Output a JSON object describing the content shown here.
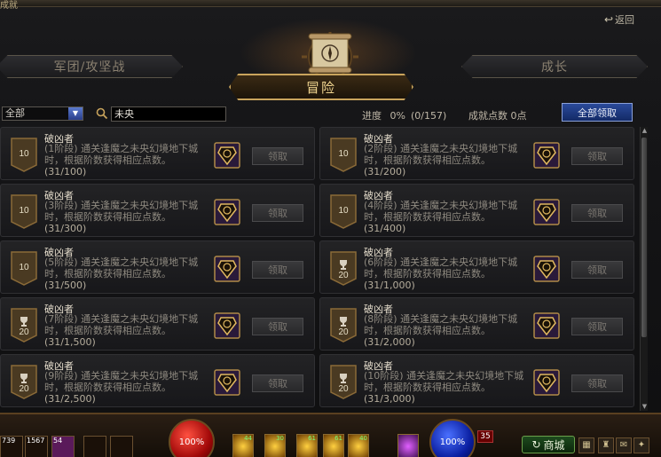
{
  "window": {
    "title": "成就",
    "back_label": "返回"
  },
  "tabs": {
    "left": "军团/攻坚战",
    "active": "冒险",
    "right": "成长"
  },
  "filter": {
    "category_value": "全部",
    "search_value": "未央"
  },
  "stats": {
    "progress_label": "进度",
    "progress_percent": "0%",
    "progress_count": "(0/157)",
    "points_label": "成就点数",
    "points_value": "0点"
  },
  "claim_all_label": "全部领取",
  "achievements": [
    {
      "title": "破凶者",
      "desc": "(1阶段) 通关逢魔之未央幻境地下城时，根据阶数获得相应点数。",
      "progress": "(31/100)",
      "badge": "10",
      "trophy": false,
      "claim": "领取"
    },
    {
      "title": "破凶者",
      "desc": "(2阶段) 通关逢魔之未央幻境地下城时，根据阶数获得相应点数。",
      "progress": "(31/200)",
      "badge": "10",
      "trophy": false,
      "claim": "领取"
    },
    {
      "title": "破凶者",
      "desc": "(3阶段) 通关逢魔之未央幻境地下城时，根据阶数获得相应点数。",
      "progress": "(31/300)",
      "badge": "10",
      "trophy": false,
      "claim": "领取"
    },
    {
      "title": "破凶者",
      "desc": "(4阶段) 通关逢魔之未央幻境地下城时，根据阶数获得相应点数。",
      "progress": "(31/400)",
      "badge": "10",
      "trophy": false,
      "claim": "领取"
    },
    {
      "title": "破凶者",
      "desc": "(5阶段) 通关逢魔之未央幻境地下城时，根据阶数获得相应点数。",
      "progress": "(31/500)",
      "badge": "10",
      "trophy": false,
      "claim": "领取"
    },
    {
      "title": "破凶者",
      "desc": "(6阶段) 通关逢魔之未央幻境地下城时，根据阶数获得相应点数。",
      "progress": "(31/1,000)",
      "badge": "20",
      "trophy": true,
      "claim": "领取"
    },
    {
      "title": "破凶者",
      "desc": "(7阶段) 通关逢魔之未央幻境地下城时，根据阶数获得相应点数。",
      "progress": "(31/1,500)",
      "badge": "20",
      "trophy": true,
      "claim": "领取"
    },
    {
      "title": "破凶者",
      "desc": "(8阶段) 通关逢魔之未央幻境地下城时，根据阶数获得相应点数。",
      "progress": "(31/2,000)",
      "badge": "20",
      "trophy": true,
      "claim": "领取"
    },
    {
      "title": "破凶者",
      "desc": "(9阶段) 通关逢魔之未央幻境地下城时，根据阶数获得相应点数。",
      "progress": "(31/2,500)",
      "badge": "20",
      "trophy": true,
      "claim": "领取"
    },
    {
      "title": "破凶者",
      "desc": "(10阶段) 通关逢魔之未央幻境地下城时，根据阶数获得相应点数。",
      "progress": "(31/3,000)",
      "badge": "20",
      "trophy": true,
      "claim": "领取"
    }
  ],
  "hud": {
    "hp_percent": "100%",
    "mp_percent": "100%",
    "level": "35",
    "shop_label": "商城",
    "slot_counts": [
      "739",
      "1567",
      "54"
    ],
    "skill_keys": [
      "44",
      "30",
      "61",
      "61",
      "",
      "40"
    ],
    "colors": {
      "accent_gold": "#c9a45c",
      "claim_blue": "#2a4a9a",
      "hp_red": "#a00808",
      "mp_blue": "#0a1ea0"
    }
  }
}
